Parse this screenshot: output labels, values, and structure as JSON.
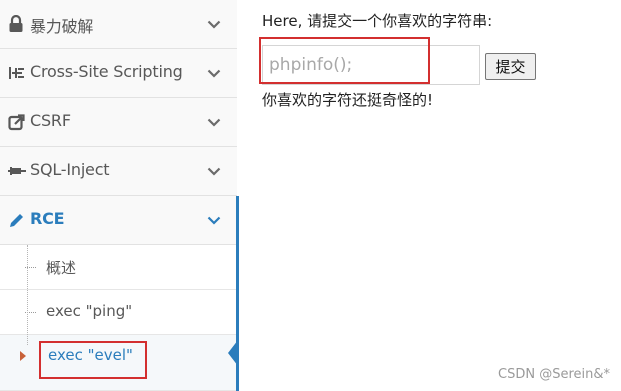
{
  "sidebar": {
    "items": [
      {
        "label": "暴力破解",
        "icon": "lock-icon"
      },
      {
        "label": "Cross-Site Scripting",
        "icon": "xss-icon"
      },
      {
        "label": "CSRF",
        "icon": "share-icon"
      },
      {
        "label": "SQL-Inject",
        "icon": "syringe-icon"
      },
      {
        "label": "RCE",
        "icon": "pencil-icon",
        "active": true
      }
    ],
    "submenu": [
      {
        "label": "概述"
      },
      {
        "label": "exec \"ping\""
      },
      {
        "label": "exec \"evel\"",
        "active": true
      }
    ]
  },
  "main": {
    "prompt": "Here, 请提交一个你喜欢的字符串:",
    "input": {
      "value": "",
      "placeholder": "phpinfo();"
    },
    "submit_label": "提交",
    "result": "你喜欢的字符还挺奇怪的!"
  },
  "watermark": "CSDN @Serein&*",
  "colors": {
    "accent": "#2b7dbc",
    "highlight_box": "#d32f2f",
    "arrow": "#c86139"
  }
}
